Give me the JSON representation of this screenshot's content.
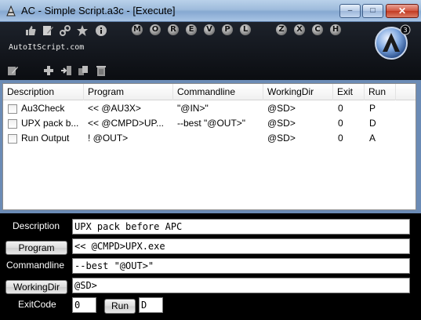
{
  "window": {
    "title": "AC - Simple Script.a3c - [Execute]",
    "minimize_glyph": "–",
    "maximize_glyph": "□",
    "close_glyph": "✕"
  },
  "toolbar": {
    "letters": [
      "M",
      "O",
      "R",
      "E",
      "V",
      "P",
      "L",
      "Z",
      "X",
      "C",
      "H"
    ],
    "site_label": "AutoItScript.com",
    "logo_badge": "3"
  },
  "list": {
    "columns": [
      "Description",
      "Program",
      "Commandline",
      "WorkingDir",
      "Exit",
      "Run"
    ],
    "rows": [
      {
        "description": "Au3Check",
        "program": "<< @AU3X>",
        "commandline": "\"@IN>\"",
        "workingdir": "@SD>",
        "exit": "0",
        "run": "P"
      },
      {
        "description": "UPX pack b...",
        "program": "<< @CMPD>UP...",
        "commandline": "--best \"@OUT>\"",
        "workingdir": "@SD>",
        "exit": "0",
        "run": "D"
      },
      {
        "description": "Run Output",
        "program": "! @OUT>",
        "commandline": "",
        "workingdir": "@SD>",
        "exit": "0",
        "run": "A"
      }
    ]
  },
  "form": {
    "description_label": "Description",
    "description_value": "UPX pack before APC",
    "program_button": "Program",
    "program_value": "<< @CMPD>UPX.exe",
    "commandline_label": "Commandline",
    "commandline_value": "--best \"@OUT>\"",
    "workingdir_button": "WorkingDir",
    "workingdir_value": "@SD>",
    "exitcode_label": "ExitCode",
    "exitcode_value": "0",
    "run_button": "Run",
    "run_value": "D"
  },
  "colors": {
    "toolbar_bg": "#0b0d11",
    "form_bg": "#000000",
    "logo_blue": "#3a7bd5"
  }
}
